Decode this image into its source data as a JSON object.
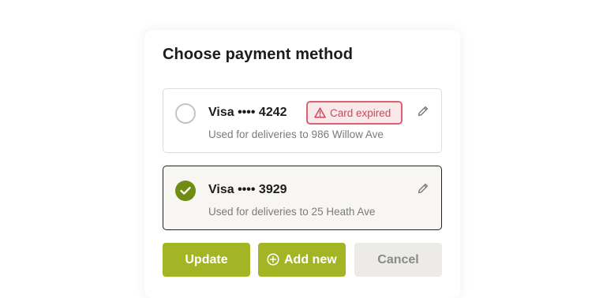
{
  "dialog": {
    "title": "Choose payment method"
  },
  "payment_methods": [
    {
      "name": "Visa •••• 4242",
      "description": "Used for deliveries to 986 Willow Ave",
      "selected": false,
      "badge": "Card expired"
    },
    {
      "name": "Visa •••• 3929",
      "description": "Used for deliveries to 25 Heath Ave",
      "selected": true
    }
  ],
  "actions": {
    "update_label": "Update",
    "add_new_label": "Add new",
    "cancel_label": "Cancel"
  },
  "icons": {
    "edit": "pencil-icon",
    "warning": "warning-triangle-icon",
    "add": "plus-circle-icon",
    "check": "check-icon"
  },
  "colors": {
    "accent": "#a3b424",
    "selected_radio": "#6f8c13",
    "error": "#c84a58",
    "error_bg": "#fbe8ea"
  }
}
